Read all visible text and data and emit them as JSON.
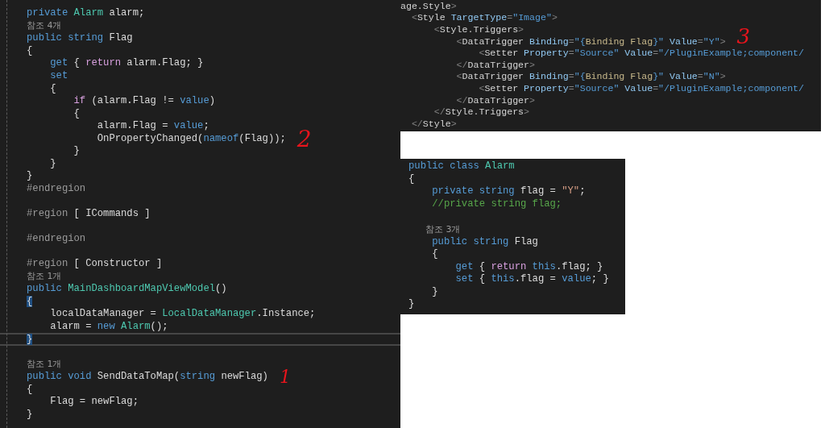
{
  "csharp_editor": {
    "lines": [
      {
        "kind": "code",
        "segments": [
          {
            "kind": "kw",
            "text": "private "
          },
          {
            "kind": "type",
            "text": "Alarm "
          },
          {
            "kind": "txt",
            "text": "alarm;"
          }
        ]
      },
      {
        "kind": "code",
        "segments": [
          {
            "kind": "lens",
            "text": "참조 4개"
          }
        ]
      },
      {
        "kind": "code",
        "segments": [
          {
            "kind": "kw",
            "text": "public string "
          },
          {
            "kind": "txt",
            "text": "Flag"
          }
        ]
      },
      {
        "kind": "code",
        "segments": [
          {
            "kind": "txt",
            "text": "{"
          }
        ]
      },
      {
        "kind": "code",
        "segments": [
          {
            "kind": "kw",
            "text": "    get"
          },
          {
            "kind": "txt",
            "text": " { "
          },
          {
            "kind": "ctrl",
            "text": "return"
          },
          {
            "kind": "txt",
            "text": " alarm.Flag; }"
          }
        ]
      },
      {
        "kind": "code",
        "segments": [
          {
            "kind": "kw",
            "text": "    set"
          }
        ]
      },
      {
        "kind": "code",
        "segments": [
          {
            "kind": "txt",
            "text": "    {"
          }
        ]
      },
      {
        "kind": "code",
        "segments": [
          {
            "kind": "ctrl",
            "text": "        if"
          },
          {
            "kind": "txt",
            "text": " (alarm.Flag != "
          },
          {
            "kind": "kw",
            "text": "value"
          },
          {
            "kind": "txt",
            "text": ")"
          }
        ]
      },
      {
        "kind": "code",
        "segments": [
          {
            "kind": "txt",
            "text": "        {"
          }
        ]
      },
      {
        "kind": "code",
        "segments": [
          {
            "kind": "txt",
            "text": "            alarm.Flag = "
          },
          {
            "kind": "kw",
            "text": "value"
          },
          {
            "kind": "txt",
            "text": ";"
          }
        ]
      },
      {
        "kind": "code",
        "annotation": "2",
        "segments": [
          {
            "kind": "txt",
            "text": "            OnPropertyChanged("
          },
          {
            "kind": "kw",
            "text": "nameof"
          },
          {
            "kind": "txt",
            "text": "(Flag));"
          }
        ]
      },
      {
        "kind": "code",
        "segments": [
          {
            "kind": "txt",
            "text": "        }"
          }
        ]
      },
      {
        "kind": "code",
        "segments": [
          {
            "kind": "txt",
            "text": "    }"
          }
        ]
      },
      {
        "kind": "code",
        "segments": [
          {
            "kind": "txt",
            "text": "}"
          }
        ]
      },
      {
        "kind": "code",
        "segments": [
          {
            "kind": "pre",
            "text": "#endregion"
          }
        ]
      },
      {
        "kind": "blank"
      },
      {
        "kind": "code",
        "segments": [
          {
            "kind": "pre",
            "text": "#region"
          },
          {
            "kind": "txt",
            "text": " [ ICommands ]"
          }
        ]
      },
      {
        "kind": "blank"
      },
      {
        "kind": "code",
        "segments": [
          {
            "kind": "pre",
            "text": "#endregion"
          }
        ]
      },
      {
        "kind": "blank"
      },
      {
        "kind": "code",
        "segments": [
          {
            "kind": "pre",
            "text": "#region"
          },
          {
            "kind": "txt",
            "text": " [ Constructor ]"
          }
        ]
      },
      {
        "kind": "code",
        "segments": [
          {
            "kind": "lens",
            "text": "참조 1개"
          }
        ]
      },
      {
        "kind": "code",
        "segments": [
          {
            "kind": "kw",
            "text": "public "
          },
          {
            "kind": "type",
            "text": "MainDashboardMapViewModel"
          },
          {
            "kind": "txt",
            "text": "()"
          }
        ]
      },
      {
        "kind": "code",
        "segments": [
          {
            "kind": "match",
            "text": "{"
          }
        ]
      },
      {
        "kind": "code",
        "segments": [
          {
            "kind": "txt",
            "text": "    localDataManager = "
          },
          {
            "kind": "type",
            "text": "LocalDataManager"
          },
          {
            "kind": "txt",
            "text": ".Instance;"
          }
        ]
      },
      {
        "kind": "code",
        "segments": [
          {
            "kind": "txt",
            "text": "    alarm = "
          },
          {
            "kind": "kw",
            "text": "new "
          },
          {
            "kind": "type",
            "text": "Alarm"
          },
          {
            "kind": "txt",
            "text": "();"
          }
        ]
      },
      {
        "kind": "code",
        "current": true,
        "segments": [
          {
            "kind": "match",
            "text": "}"
          }
        ]
      },
      {
        "kind": "blank"
      },
      {
        "kind": "code",
        "segments": [
          {
            "kind": "lens",
            "text": "참조 1개"
          }
        ]
      },
      {
        "kind": "code",
        "annotation": "1",
        "segments": [
          {
            "kind": "kw",
            "text": "public void "
          },
          {
            "kind": "txt",
            "text": "SendDataToMap("
          },
          {
            "kind": "kw",
            "text": "string "
          },
          {
            "kind": "txt",
            "text": "newFlag)"
          }
        ]
      },
      {
        "kind": "code",
        "segments": [
          {
            "kind": "txt",
            "text": "{"
          }
        ]
      },
      {
        "kind": "code",
        "segments": [
          {
            "kind": "txt",
            "text": "    Flag = newFlag;"
          }
        ]
      },
      {
        "kind": "code",
        "segments": [
          {
            "kind": "txt",
            "text": "}"
          }
        ]
      }
    ]
  },
  "xaml_editor": {
    "lines": [
      {
        "kind": "code",
        "segments": [
          {
            "kind": "xtag",
            "text": "age.Style"
          },
          {
            "kind": "xpun",
            "text": ">"
          }
        ]
      },
      {
        "kind": "code",
        "segments": [
          {
            "kind": "xpun",
            "text": "  <"
          },
          {
            "kind": "xtag",
            "text": "Style"
          },
          {
            "kind": "xattr",
            "text": " TargetType"
          },
          {
            "kind": "xpun",
            "text": "="
          },
          {
            "kind": "xval",
            "text": "\"Image\""
          },
          {
            "kind": "xpun",
            "text": ">"
          }
        ]
      },
      {
        "kind": "code",
        "segments": [
          {
            "kind": "xpun",
            "text": "      <"
          },
          {
            "kind": "xtag",
            "text": "Style.Triggers"
          },
          {
            "kind": "xpun",
            "text": ">"
          }
        ]
      },
      {
        "kind": "code",
        "annotation": "3",
        "segments": [
          {
            "kind": "xpun",
            "text": "          <"
          },
          {
            "kind": "xtag",
            "text": "DataTrigger"
          },
          {
            "kind": "xattr",
            "text": " Binding"
          },
          {
            "kind": "xpun",
            "text": "="
          },
          {
            "kind": "xval",
            "text": "\"{"
          },
          {
            "kind": "xbind",
            "text": "Binding Flag"
          },
          {
            "kind": "xval",
            "text": "}\""
          },
          {
            "kind": "xattr",
            "text": " Value"
          },
          {
            "kind": "xpun",
            "text": "="
          },
          {
            "kind": "xval",
            "text": "\"Y\""
          },
          {
            "kind": "xpun",
            "text": ">"
          }
        ]
      },
      {
        "kind": "code",
        "segments": [
          {
            "kind": "xpun",
            "text": "              <"
          },
          {
            "kind": "xtag",
            "text": "Setter"
          },
          {
            "kind": "xattr",
            "text": " Property"
          },
          {
            "kind": "xpun",
            "text": "="
          },
          {
            "kind": "xval",
            "text": "\"Source\""
          },
          {
            "kind": "xattr",
            "text": " Value"
          },
          {
            "kind": "xpun",
            "text": "="
          },
          {
            "kind": "xval",
            "text": "\"/PluginExample;component/"
          }
        ]
      },
      {
        "kind": "code",
        "segments": [
          {
            "kind": "xpun",
            "text": "          </"
          },
          {
            "kind": "xtag",
            "text": "DataTrigger"
          },
          {
            "kind": "xpun",
            "text": ">"
          }
        ]
      },
      {
        "kind": "code",
        "segments": [
          {
            "kind": "xpun",
            "text": "          <"
          },
          {
            "kind": "xtag",
            "text": "DataTrigger"
          },
          {
            "kind": "xattr",
            "text": " Binding"
          },
          {
            "kind": "xpun",
            "text": "="
          },
          {
            "kind": "xval",
            "text": "\"{"
          },
          {
            "kind": "xbind",
            "text": "Binding Flag"
          },
          {
            "kind": "xval",
            "text": "}\""
          },
          {
            "kind": "xattr",
            "text": " Value"
          },
          {
            "kind": "xpun",
            "text": "="
          },
          {
            "kind": "xval",
            "text": "\"N\""
          },
          {
            "kind": "xpun",
            "text": ">"
          }
        ]
      },
      {
        "kind": "code",
        "segments": [
          {
            "kind": "xpun",
            "text": "              <"
          },
          {
            "kind": "xtag",
            "text": "Setter"
          },
          {
            "kind": "xattr",
            "text": " Property"
          },
          {
            "kind": "xpun",
            "text": "="
          },
          {
            "kind": "xval",
            "text": "\"Source\""
          },
          {
            "kind": "xattr",
            "text": " Value"
          },
          {
            "kind": "xpun",
            "text": "="
          },
          {
            "kind": "xval",
            "text": "\"/PluginExample;component/"
          }
        ]
      },
      {
        "kind": "code",
        "segments": [
          {
            "kind": "xpun",
            "text": "          </"
          },
          {
            "kind": "xtag",
            "text": "DataTrigger"
          },
          {
            "kind": "xpun",
            "text": ">"
          }
        ]
      },
      {
        "kind": "code",
        "segments": [
          {
            "kind": "xpun",
            "text": "      </"
          },
          {
            "kind": "xtag",
            "text": "Style.Triggers"
          },
          {
            "kind": "xpun",
            "text": ">"
          }
        ]
      },
      {
        "kind": "code",
        "segments": [
          {
            "kind": "xpun",
            "text": "  </"
          },
          {
            "kind": "xtag",
            "text": "Style"
          },
          {
            "kind": "xpun",
            "text": ">"
          }
        ]
      }
    ]
  },
  "class_editor": {
    "lines": [
      {
        "kind": "code",
        "segments": [
          {
            "kind": "kw",
            "text": "public class "
          },
          {
            "kind": "type",
            "text": "Alarm"
          }
        ]
      },
      {
        "kind": "code",
        "segments": [
          {
            "kind": "txt",
            "text": "{"
          }
        ]
      },
      {
        "kind": "code",
        "segments": [
          {
            "kind": "kw",
            "text": "    private string "
          },
          {
            "kind": "txt",
            "text": "flag = "
          },
          {
            "kind": "str",
            "text": "\"Y\""
          },
          {
            "kind": "txt",
            "text": ";"
          }
        ]
      },
      {
        "kind": "code",
        "segments": [
          {
            "kind": "cmt",
            "text": "    //private string flag;"
          }
        ]
      },
      {
        "kind": "blank"
      },
      {
        "kind": "code",
        "segments": [
          {
            "kind": "lens",
            "text": "      참조 3개"
          }
        ]
      },
      {
        "kind": "code",
        "segments": [
          {
            "kind": "kw",
            "text": "    public string "
          },
          {
            "kind": "txt",
            "text": "Flag"
          }
        ]
      },
      {
        "kind": "code",
        "segments": [
          {
            "kind": "txt",
            "text": "    {"
          }
        ]
      },
      {
        "kind": "code",
        "segments": [
          {
            "kind": "kw",
            "text": "        get"
          },
          {
            "kind": "txt",
            "text": " { "
          },
          {
            "kind": "ctrl",
            "text": "return"
          },
          {
            "kind": "kw",
            "text": " this"
          },
          {
            "kind": "txt",
            "text": ".flag; }"
          }
        ]
      },
      {
        "kind": "code",
        "segments": [
          {
            "kind": "kw",
            "text": "        set"
          },
          {
            "kind": "txt",
            "text": " { "
          },
          {
            "kind": "kw",
            "text": "this"
          },
          {
            "kind": "txt",
            "text": ".flag = "
          },
          {
            "kind": "kw",
            "text": "value"
          },
          {
            "kind": "txt",
            "text": "; }"
          }
        ]
      },
      {
        "kind": "code",
        "segments": [
          {
            "kind": "txt",
            "text": "    }"
          }
        ]
      },
      {
        "kind": "code",
        "segments": [
          {
            "kind": "txt",
            "text": "}"
          }
        ]
      }
    ]
  }
}
